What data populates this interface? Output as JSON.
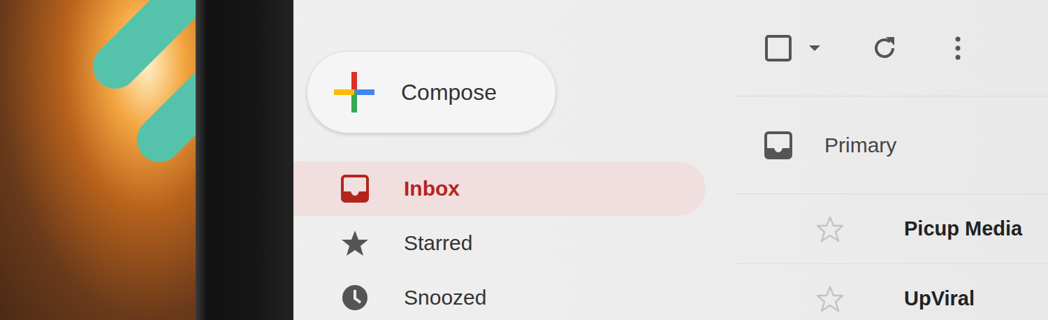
{
  "sidebar": {
    "compose": "Compose",
    "items": [
      {
        "label": "Inbox",
        "selected": true
      },
      {
        "label": "Starred",
        "selected": false
      },
      {
        "label": "Snoozed",
        "selected": false
      }
    ]
  },
  "toolbar": {
    "select_all": {
      "checked": false
    }
  },
  "category": {
    "label": "Primary"
  },
  "emails": [
    {
      "sender": "Picup Media",
      "starred": false,
      "unread": true
    },
    {
      "sender": "UpViral",
      "starred": false,
      "unread": true
    }
  ]
}
